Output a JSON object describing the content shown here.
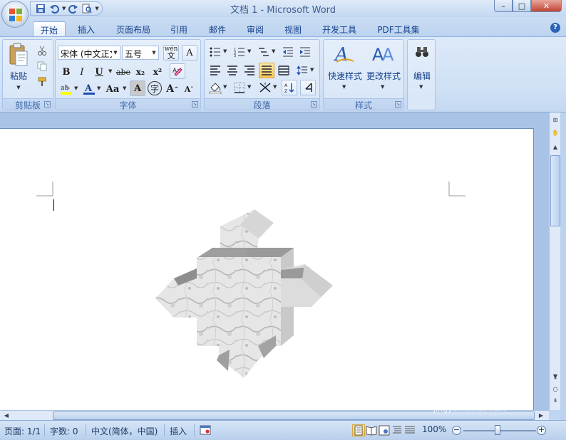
{
  "window": {
    "title": "文档 1 - Microsoft Word",
    "controls": {
      "minimize": "–",
      "maximize": "□",
      "close": "✕"
    }
  },
  "quick_access": {
    "save_icon": "save-icon",
    "undo_icon": "undo-icon",
    "redo_icon": "redo-icon",
    "print_preview_icon": "print-preview-icon"
  },
  "tabs": [
    {
      "label": "开始",
      "active": true
    },
    {
      "label": "插入"
    },
    {
      "label": "页面布局"
    },
    {
      "label": "引用"
    },
    {
      "label": "邮件"
    },
    {
      "label": "审阅"
    },
    {
      "label": "视图"
    },
    {
      "label": "开发工具"
    },
    {
      "label": "PDF工具集"
    }
  ],
  "ribbon": {
    "clipboard": {
      "label": "剪贴板",
      "paste": "粘贴"
    },
    "font": {
      "label": "字体",
      "font_name": "宋体 (中文正文)",
      "font_size": "五号",
      "bold": "B",
      "italic": "I",
      "underline": "U",
      "strike": "abe",
      "subscript": "x₂",
      "superscript": "x²",
      "change_case": "Aa",
      "grow": "A",
      "shrink": "A",
      "char_border": "A",
      "enclose": "字",
      "phonetic": "wén"
    },
    "paragraph": {
      "label": "段落"
    },
    "styles": {
      "label": "样式",
      "quick_styles": "快速样式",
      "change_styles": "更改样式"
    },
    "editing": {
      "label": "编辑"
    }
  },
  "status": {
    "page": "页面: 1/1",
    "words": "字数: 0",
    "language": "中文(简体，中国)",
    "mode": "插入",
    "zoom": "100%"
  },
  "watermark": {
    "brand": "Baidu经验",
    "url": "jingyan.baidu.com"
  }
}
